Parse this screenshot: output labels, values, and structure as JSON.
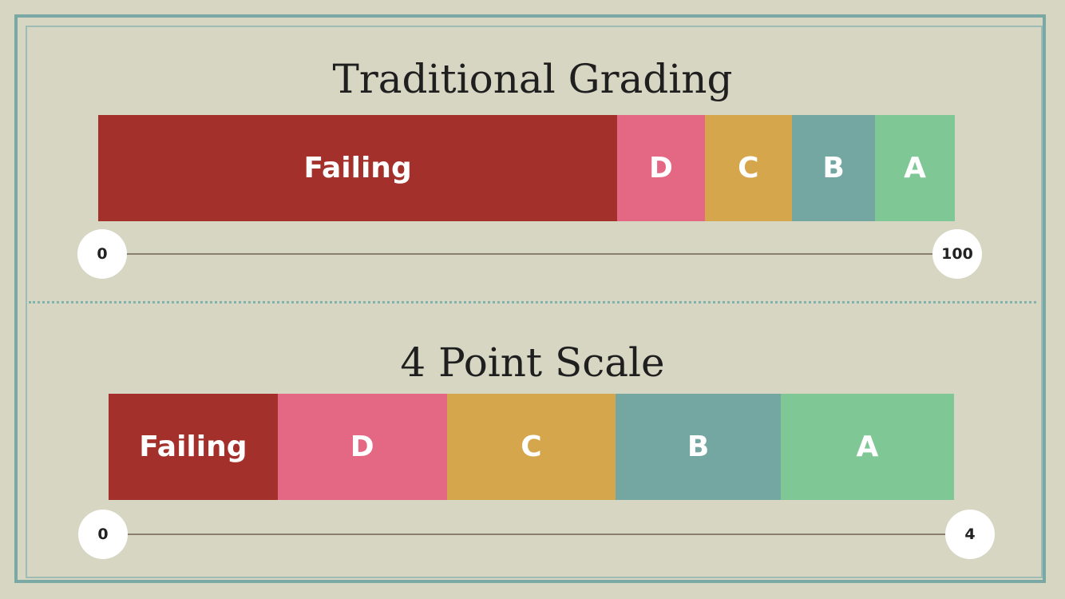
{
  "traditional": {
    "title": "Traditional Grading",
    "axis_min": "0",
    "axis_max": "100",
    "segments": [
      {
        "label": "Failing",
        "from": 0,
        "to": 60.6,
        "color": "#a3302a"
      },
      {
        "label": "D",
        "from": 60.6,
        "to": 70.8,
        "color": "#e46783"
      },
      {
        "label": "C",
        "from": 70.8,
        "to": 81.0,
        "color": "#d6a64d"
      },
      {
        "label": "B",
        "from": 81.0,
        "to": 90.7,
        "color": "#74a6a2"
      },
      {
        "label": "A",
        "from": 90.7,
        "to": 100,
        "color": "#7fc795"
      }
    ]
  },
  "four_point": {
    "title": "4 Point Scale",
    "axis_min": "0",
    "axis_max": "4",
    "segments": [
      {
        "label": "Failing",
        "from": 0,
        "to": 0.8,
        "color": "#a3302a"
      },
      {
        "label": "D",
        "from": 0.8,
        "to": 1.6,
        "color": "#e46783"
      },
      {
        "label": "C",
        "from": 1.6,
        "to": 2.4,
        "color": "#d6a64d"
      },
      {
        "label": "B",
        "from": 2.4,
        "to": 3.18,
        "color": "#74a6a2"
      },
      {
        "label": "A",
        "from": 3.18,
        "to": 4,
        "color": "#7fc795"
      }
    ]
  },
  "colors": {
    "background": "#d6d6c2",
    "frame": "#7aa8a4",
    "divider": "#7fb3ad"
  }
}
